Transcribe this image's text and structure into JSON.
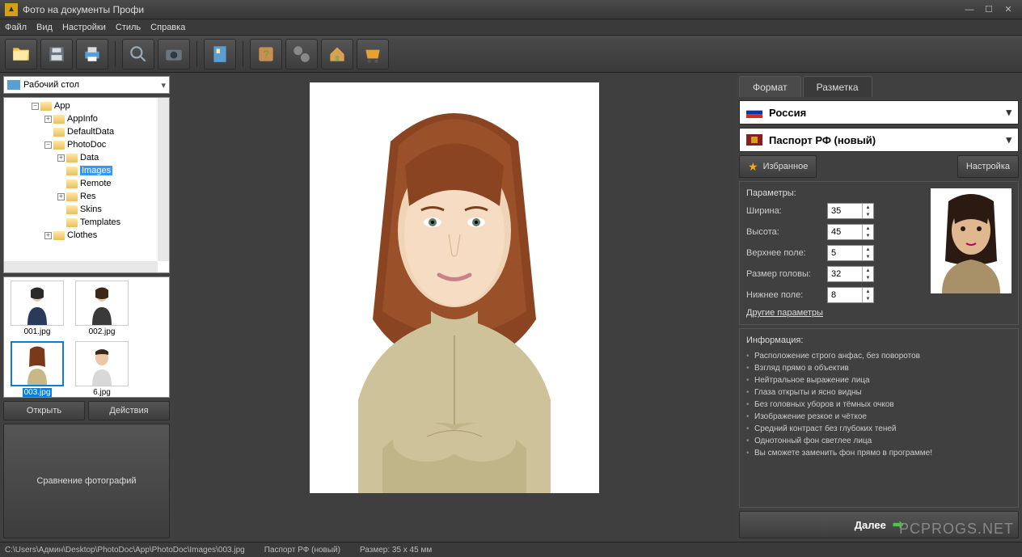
{
  "window": {
    "title": "Фото на документы Профи"
  },
  "menu": {
    "file": "Файл",
    "view": "Вид",
    "settings": "Настройки",
    "style": "Стиль",
    "help": "Справка"
  },
  "left": {
    "path": "Рабочий стол",
    "tree": [
      "App",
      "AppInfo",
      "DefaultData",
      "PhotoDoc",
      "Data",
      "Images",
      "Remote",
      "Res",
      "Skins",
      "Templates",
      "Clothes"
    ],
    "thumbs": [
      "001.jpg",
      "002.jpg",
      "003.jpg",
      "6.jpg"
    ],
    "open": "Открыть",
    "actions": "Действия",
    "compare": "Сравнение фотографий"
  },
  "right": {
    "tab_format": "Формат",
    "tab_layout": "Разметка",
    "country": "Россия",
    "doc": "Паспорт РФ (новый)",
    "favorite": "Избранное",
    "configure": "Настройка",
    "params_title": "Параметры:",
    "width_l": "Ширина:",
    "width_v": "35",
    "height_l": "Высота:",
    "height_v": "45",
    "top_l": "Верхнее поле:",
    "top_v": "5",
    "head_l": "Размер головы:",
    "head_v": "32",
    "bottom_l": "Нижнее поле:",
    "bottom_v": "8",
    "other": "Другие параметры",
    "info_title": "Информация:",
    "info": [
      "Расположение строго анфас, без поворотов",
      "Взгляд прямо в объектив",
      "Нейтральное выражение лица",
      "Глаза открыты и ясно видны",
      "Без головных уборов и тёмных очков",
      "Изображение резкое и чёткое",
      "Средний контраст без глубоких теней",
      "Однотонный фон светлее лица",
      "Вы сможете заменить фон прямо в программе!"
    ],
    "next": "Далее"
  },
  "status": {
    "path": "C:\\Users\\Админ\\Desktop\\PhotoDoc\\App\\PhotoDoc\\Images\\003.jpg",
    "doc": "Паспорт РФ (новый)",
    "size": "Размер: 35 x 45 мм"
  },
  "watermark": "PCPROGS.NET"
}
